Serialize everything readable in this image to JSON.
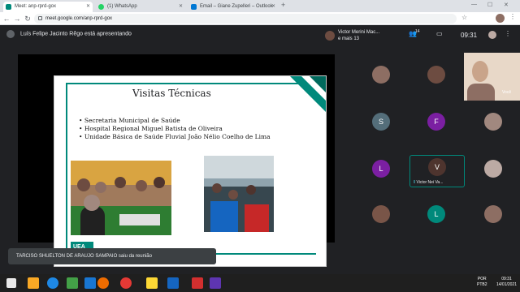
{
  "browser": {
    "tabs": [
      {
        "label": "Meet: anp-rprd-gox",
        "color": "#00897b",
        "active": true
      },
      {
        "label": "(1) WhatsApp",
        "color": "#25d366",
        "active": false
      },
      {
        "label": "Email – Giane Zupelleri – Outlook",
        "color": "#0078d4",
        "active": false
      }
    ],
    "url": "meet.google.com/anp-rprd-gox"
  },
  "meet": {
    "presenter_text": "Luís Felipe Jacinto Rêgo está apresentando",
    "header_name": "Victor Merini Mac...",
    "header_more": "e mais 13",
    "participants_count": "14",
    "time": "09:31",
    "self_label": "Você",
    "speaking_label": "Victor Nei Va...",
    "tiles": [
      {
        "letter": "",
        "color": "#8d6e63"
      },
      {
        "letter": "",
        "color": "#6d4c41"
      },
      {
        "letter": "S",
        "color": "#546e7a"
      },
      {
        "letter": "F",
        "color": "#7b1fa2"
      },
      {
        "letter": "",
        "color": "#a1887f"
      },
      {
        "letter": "L",
        "color": "#7b1fa2"
      },
      {
        "letter": "V",
        "color": "#4e342e"
      },
      {
        "letter": "",
        "color": "#bcaaa4"
      },
      {
        "letter": "",
        "color": "#795548"
      },
      {
        "letter": "L",
        "color": "#00897b"
      },
      {
        "letter": "",
        "color": "#8d6e63"
      }
    ],
    "notification": "TARCISO SHUELTON DE ARAUJO SAMPAIO saiu da reunião"
  },
  "slide": {
    "title": "Visitas Técnicas",
    "bullets": [
      "Secretaria Municipal de Saúde",
      "Hospital Regional Miguel Batista de Oliveira",
      "Unidade Básica de Saúde Fluvial João Nélio Coelho de Lima"
    ],
    "logo_text": "UEA",
    "accent": "#00897b"
  },
  "taskbar": {
    "lang": "POR",
    "lang2": "PTB2",
    "time": "09:31",
    "date": "14/01/2021"
  }
}
